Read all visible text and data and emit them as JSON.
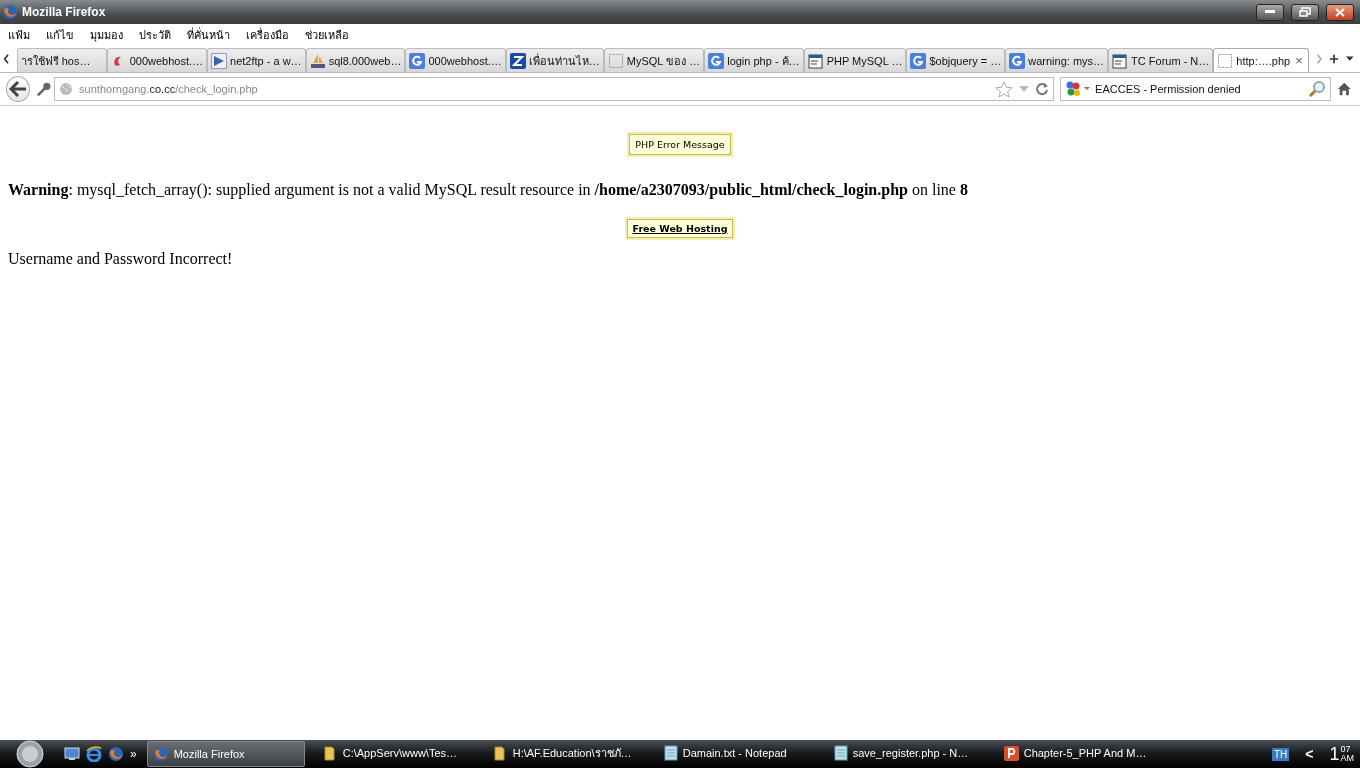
{
  "window": {
    "title": "Mozilla Firefox"
  },
  "menu": [
    "แฟ้ม",
    "แก้ไข",
    "มุมมอง",
    "ประวัติ",
    "ที่คั่นหน้า",
    "เครื่องมือ",
    "ช่วยเหลือ"
  ],
  "tabs": [
    {
      "label": "ารใช้ฟรี hos…",
      "kind": "none",
      "selected": false
    },
    {
      "label": "000webhost.…",
      "kind": "swirl",
      "selected": false
    },
    {
      "label": "net2ftp - a w…",
      "kind": "arrow",
      "selected": false
    },
    {
      "label": "sql8.000web…",
      "kind": "pma",
      "selected": false
    },
    {
      "label": "000webhost.…",
      "kind": "g",
      "selected": false
    },
    {
      "label": "เพื่อนท่านไห…",
      "kind": "z",
      "selected": false
    },
    {
      "label": "MySQL ของ …",
      "kind": "blank",
      "selected": false
    },
    {
      "label": "login php - ค้…",
      "kind": "g",
      "selected": false
    },
    {
      "label": "PHP MySQL …",
      "kind": "doc",
      "selected": false
    },
    {
      "label": "$objquery = …",
      "kind": "g",
      "selected": false
    },
    {
      "label": "warning: mys…",
      "kind": "g",
      "selected": false
    },
    {
      "label": "TC Forum - N…",
      "kind": "doc",
      "selected": false
    },
    {
      "label": "http:….php",
      "kind": "blank",
      "selected": true,
      "close": "×"
    }
  ],
  "address": {
    "host": "sunthorngang.",
    "domain": "co.cc",
    "path": "/check_login.php"
  },
  "search": {
    "value": "EACCES - Permission denied"
  },
  "page": {
    "badge_top": "PHP Error Message",
    "warning": "**Warning**: mysql_fetch_array(): supplied argument is not a valid MySQL result resource in **/home/a2307093/public_html/check_login.php** on line **8**",
    "badge_link": "Free Web Hosting",
    "message": "Username and Password Incorrect!"
  },
  "taskbar": {
    "more": "»",
    "tasks": [
      {
        "label": "Mozilla Firefox",
        "kind": "firefox",
        "selected": true
      },
      {
        "label": "C:\\AppServ\\www\\Tes…",
        "kind": "folder",
        "selected": false
      },
      {
        "label": "H:\\AF.Education\\ราชภั…",
        "kind": "folder",
        "selected": false
      },
      {
        "label": "Damain.txt - Notepad",
        "kind": "notepad",
        "selected": false
      },
      {
        "label": "save_register.php - N…",
        "kind": "notepad",
        "selected": false
      },
      {
        "label": "Chapter-5_PHP And M…",
        "kind": "ppt",
        "selected": false
      }
    ],
    "language": "TH",
    "tray_toggle": "<",
    "clock": {
      "hour": "1",
      "minute": "07",
      "period": "AM"
    }
  }
}
